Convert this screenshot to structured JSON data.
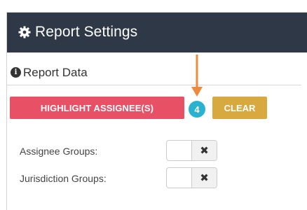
{
  "header": {
    "title": "Report Settings",
    "icon": "gear-icon"
  },
  "section": {
    "title": "Report Data",
    "icon": "info-icon",
    "info_glyph": "i"
  },
  "actions": {
    "highlight_label": "HIGHLIGHT ASSIGNEE(S)",
    "count": "4",
    "clear_label": "CLEAR"
  },
  "fields": [
    {
      "label": "Assignee Groups:",
      "toggle_icon": "close-icon",
      "toggle_glyph": "✖"
    },
    {
      "label": "Jurisdiction Groups:",
      "toggle_icon": "close-icon",
      "toggle_glyph": "✖"
    }
  ],
  "colors": {
    "header_bg": "#2e3846",
    "highlight_button": "#e85066",
    "count_badge": "#29b3d1",
    "clear_button": "#d8a93e",
    "annotation_arrow": "#ec8a3e"
  }
}
